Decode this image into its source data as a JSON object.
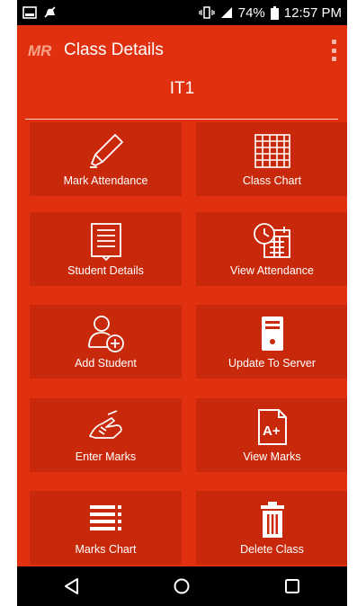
{
  "status_bar": {
    "battery": "74%",
    "time": "12:57 PM"
  },
  "app_bar": {
    "logo_text": "MR",
    "title": "Class Details"
  },
  "class_name": "IT1",
  "tiles": [
    {
      "label": "Mark Attendance",
      "icon": "highlighter-icon"
    },
    {
      "label": "Class Chart",
      "icon": "grid-table-icon"
    },
    {
      "label": "Student Details",
      "icon": "document-list-icon"
    },
    {
      "label": "View Attendance",
      "icon": "calendar-clock-icon"
    },
    {
      "label": "Add Student",
      "icon": "add-user-icon"
    },
    {
      "label": "Update To Server",
      "icon": "server-icon"
    },
    {
      "label": "Enter Marks",
      "icon": "writing-hand-icon"
    },
    {
      "label": "View Marks",
      "icon": "grade-document-icon"
    },
    {
      "label": "Marks Chart",
      "icon": "list-bullets-icon"
    },
    {
      "label": "Delete Class",
      "icon": "trash-icon"
    }
  ],
  "colors": {
    "background": "#e0300f",
    "tile": "#c8290b",
    "text": "#ffffff"
  }
}
